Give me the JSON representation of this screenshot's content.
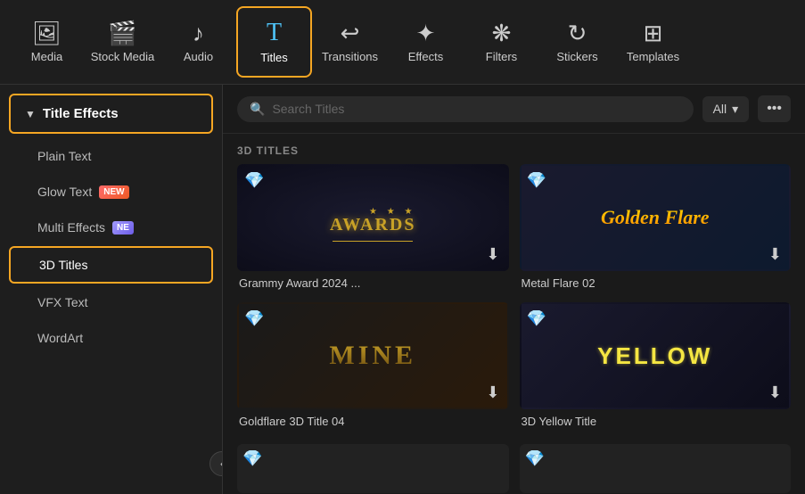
{
  "nav": {
    "items": [
      {
        "id": "media",
        "label": "Media",
        "icon": "🖼",
        "active": false
      },
      {
        "id": "stock-media",
        "label": "Stock Media",
        "icon": "🎬",
        "active": false
      },
      {
        "id": "audio",
        "label": "Audio",
        "icon": "🎵",
        "active": false
      },
      {
        "id": "titles",
        "label": "Titles",
        "icon": "T",
        "active": true
      },
      {
        "id": "transitions",
        "label": "Transitions",
        "icon": "↩",
        "active": false
      },
      {
        "id": "effects",
        "label": "Effects",
        "icon": "✨",
        "active": false
      },
      {
        "id": "filters",
        "label": "Filters",
        "icon": "🎨",
        "active": false
      },
      {
        "id": "stickers",
        "label": "Stickers",
        "icon": "🎯",
        "active": false
      },
      {
        "id": "templates",
        "label": "Templates",
        "icon": "⊞",
        "active": false
      }
    ]
  },
  "sidebar": {
    "section_label": "Title Effects",
    "items": [
      {
        "id": "plain-text",
        "label": "Plain Text",
        "badge": null,
        "active": false
      },
      {
        "id": "glow-text",
        "label": "Glow Text",
        "badge": "NEW",
        "badge_type": "new",
        "active": false
      },
      {
        "id": "multi-effects",
        "label": "Multi Effects",
        "badge": "NE",
        "badge_type": "ne",
        "active": false
      },
      {
        "id": "3d-titles",
        "label": "3D Titles",
        "badge": null,
        "active": true
      },
      {
        "id": "vfx-text",
        "label": "VFX Text",
        "badge": null,
        "active": false
      },
      {
        "id": "wordart",
        "label": "WordArt",
        "badge": null,
        "active": false
      }
    ]
  },
  "search": {
    "placeholder": "Search Titles",
    "filter_label": "All",
    "more_icon": "•••"
  },
  "content": {
    "section_label": "3D TITLES",
    "items": [
      {
        "id": "grammy",
        "title": "Grammy Award 2024 ...",
        "thumb_type": "awards"
      },
      {
        "id": "metal-flare",
        "title": "Metal Flare 02",
        "thumb_type": "golden"
      },
      {
        "id": "goldflare",
        "title": "Goldflare 3D Title 04",
        "thumb_type": "mine"
      },
      {
        "id": "yellow",
        "title": "3D Yellow Title",
        "thumb_type": "yellow"
      }
    ],
    "awards_text": "AWARDS",
    "awards_stars": "★ ★ ★",
    "golden_text": "Golden Flare",
    "mine_text": "MINE",
    "yellow_text": "YELLOW"
  }
}
